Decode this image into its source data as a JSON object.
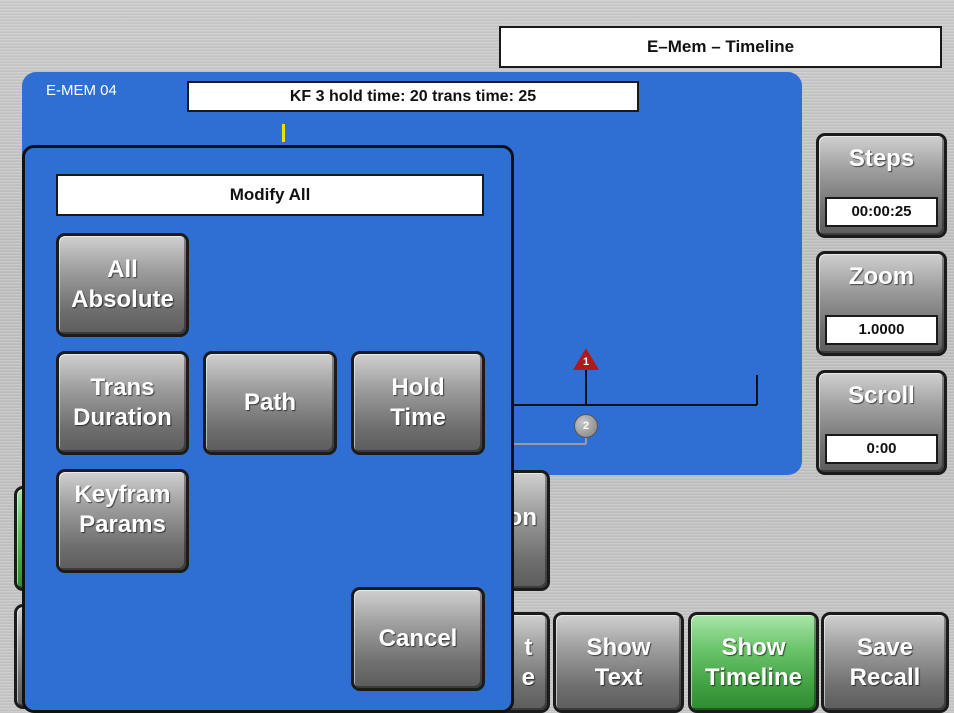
{
  "window": {
    "title": "E–Mem – Timeline"
  },
  "panel": {
    "label": "E-MEM 04",
    "info": "KF 3 hold time: 20 trans time: 25",
    "timeline": {
      "markers": [
        "1",
        "2"
      ]
    }
  },
  "side": {
    "steps": {
      "label": "Steps",
      "value": "00:00:25"
    },
    "zoom": {
      "label": "Zoom",
      "value": "1.0000"
    },
    "scroll": {
      "label": "Scroll",
      "value": "0:00"
    }
  },
  "bottom": {
    "partial_left": "t\ne",
    "partial_mid": "on",
    "show_text": "Show\nText",
    "show_timeline": "Show\nTimeline",
    "save_recall": "Save\nRecall"
  },
  "dialog": {
    "title": "Modify All",
    "all_absolute": "All\nAbsolute",
    "trans_duration": "Trans\nDuration",
    "path": "Path",
    "hold_time": "Hold\nTime",
    "keyframe_params": "Keyfram\nParams",
    "cancel": "Cancel"
  },
  "colors": {
    "panel_blue": "#2f6fd4",
    "marker_red": "#b01a1a",
    "marker_gray": "#8c8c8c",
    "active_green": "#4aa84a",
    "cursor_yellow": "#f0e000"
  }
}
